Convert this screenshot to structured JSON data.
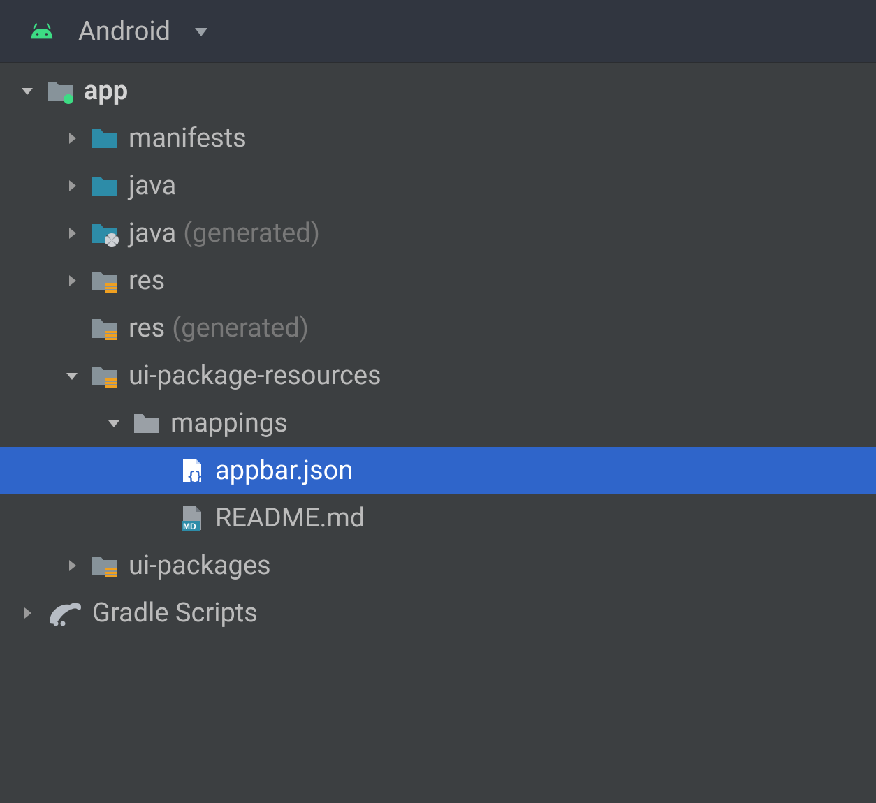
{
  "header": {
    "view_label": "Android"
  },
  "tree": [
    {
      "indent": 0,
      "arrow": "down",
      "icon": "module",
      "label": "app",
      "bold": true,
      "selected": false
    },
    {
      "indent": 1,
      "arrow": "right",
      "icon": "folder-teal",
      "label": "manifests",
      "selected": false
    },
    {
      "indent": 1,
      "arrow": "right",
      "icon": "folder-teal",
      "label": "java",
      "selected": false
    },
    {
      "indent": 1,
      "arrow": "right",
      "icon": "folder-gen",
      "label": "java",
      "suffix": "(generated)",
      "selected": false
    },
    {
      "indent": 1,
      "arrow": "right",
      "icon": "folder-res",
      "label": "res",
      "selected": false
    },
    {
      "indent": 1,
      "arrow": "none",
      "icon": "folder-res",
      "label": "res",
      "suffix": "(generated)",
      "selected": false
    },
    {
      "indent": 1,
      "arrow": "down",
      "icon": "folder-res",
      "label": "ui-package-resources",
      "selected": false
    },
    {
      "indent": 2,
      "arrow": "down",
      "icon": "folder-gray",
      "label": "mappings",
      "selected": false
    },
    {
      "indent": 3,
      "arrow": "none",
      "icon": "json-file",
      "label": "appbar.json",
      "selected": true
    },
    {
      "indent": 3,
      "arrow": "none",
      "icon": "md-file",
      "label": "README.md",
      "selected": false
    },
    {
      "indent": 1,
      "arrow": "right",
      "icon": "folder-res",
      "label": "ui-packages",
      "selected": false
    },
    {
      "indent": 0,
      "arrow": "right",
      "icon": "gradle",
      "label": "Gradle Scripts",
      "selected": false
    }
  ]
}
